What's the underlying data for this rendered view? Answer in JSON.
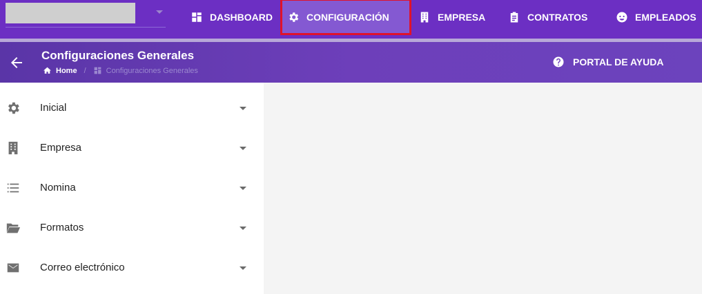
{
  "topnav": {
    "items": [
      {
        "label": "DASHBOARD",
        "icon": "dashboard-icon"
      },
      {
        "label": "CONFIGURACIÓN",
        "icon": "gear-icon",
        "active": true
      },
      {
        "label": "EMPRESA",
        "icon": "building-icon"
      },
      {
        "label": "CONTRATOS",
        "icon": "clipboard-icon"
      },
      {
        "label": "EMPLEADOS",
        "icon": "face-icon"
      }
    ]
  },
  "header": {
    "title": "Configuraciones Generales",
    "breadcrumb": {
      "home": "Home",
      "current": "Configuraciones Generales"
    },
    "help_label": "PORTAL DE AYUDA"
  },
  "sidebar": {
    "items": [
      {
        "label": "Inicial",
        "icon": "gear-icon"
      },
      {
        "label": "Empresa",
        "icon": "building-icon"
      },
      {
        "label": "Nomina",
        "icon": "list-icon"
      },
      {
        "label": "Formatos",
        "icon": "folder-open-icon"
      },
      {
        "label": "Correo electrónico",
        "icon": "mail-icon"
      }
    ]
  },
  "colors": {
    "primary": "#6c2fc3",
    "header_gradient_start": "#5a35a7",
    "active_nav_bg": "#8459d2",
    "highlight_outline": "#e0122a"
  }
}
